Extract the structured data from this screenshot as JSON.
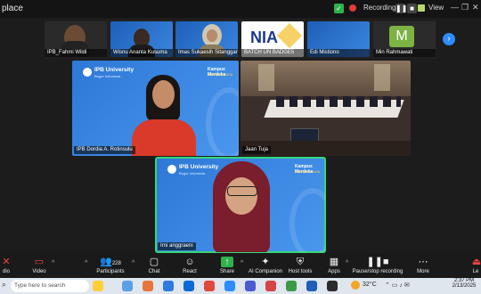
{
  "window": {
    "title": "place"
  },
  "topbar": {
    "recording_label": "Recording...",
    "view_label": "View"
  },
  "participants_strip": [
    {
      "name": "IPB_Fahmi Wildi"
    },
    {
      "name": "Wisnu Ananta Kusuma"
    },
    {
      "name": "Imas Sukaesih Sitanggang"
    },
    {
      "name": "BATCH UN BADGE5"
    },
    {
      "name": "Edi Mistiono"
    },
    {
      "name": "Min Rahmawati",
      "avatar_letter": "M"
    }
  ],
  "tiles": {
    "dordia": {
      "name": "IPB Dordia A. Rotinsulu",
      "uni": "IPB University",
      "uni_sub": "Bogor Indonesia",
      "brand": "Kampus Merdeka",
      "brand_sub": "INDONESIA JAYA"
    },
    "room": {
      "name": "Jaan Tuja"
    },
    "speaker": {
      "name": "Irni anggraeni",
      "uni": "IPB University",
      "uni_sub": "Bogor Indonesia",
      "brand": "Kampus Merdeka",
      "brand_sub": "INDONESIA JAYA"
    }
  },
  "toolbar": {
    "audio": "dio",
    "video": "Video",
    "participants": "Participants",
    "participants_count": "228",
    "chat": "Chat",
    "react": "React",
    "share": "Share",
    "companion": "AI Companion",
    "host": "Host tools",
    "apps": "Apps",
    "record": "Pause/stop recording",
    "more": "More",
    "leave": "Le"
  },
  "taskbar": {
    "search_placeholder": "Type here to search",
    "temp": "32°C",
    "time": "2:37 PM",
    "date": "2/13/2025"
  }
}
